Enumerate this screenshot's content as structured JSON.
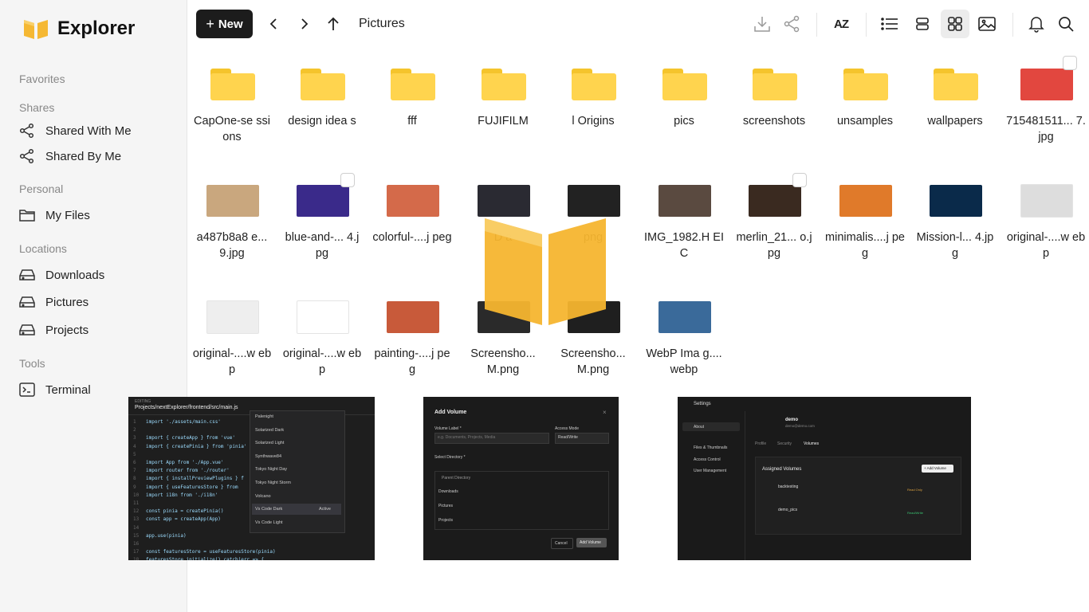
{
  "app": {
    "name": "Explorer"
  },
  "sidebar": {
    "sections": {
      "favorites": "Favorites",
      "shares": "Shares",
      "personal": "Personal",
      "locations": "Locations",
      "tools": "Tools"
    },
    "shares": [
      {
        "label": "Shared With Me",
        "icon": "share-icon"
      },
      {
        "label": "Shared By Me",
        "icon": "share-icon"
      }
    ],
    "personal": [
      {
        "label": "My Files",
        "icon": "folder-icon"
      }
    ],
    "locations": [
      {
        "label": "Downloads",
        "icon": "drive-icon"
      },
      {
        "label": "Pictures",
        "icon": "drive-icon"
      },
      {
        "label": "Projects",
        "icon": "drive-icon"
      }
    ],
    "tools": [
      {
        "label": "Terminal",
        "icon": "terminal-icon"
      }
    ]
  },
  "toolbar": {
    "new_label": "New",
    "breadcrumb": "Pictures",
    "sort_label": "AZ"
  },
  "files": [
    {
      "name": "CapOne-sessions",
      "display": "CapOne-se ssions",
      "type": "folder"
    },
    {
      "name": "design ideas",
      "display": "design idea s",
      "type": "folder"
    },
    {
      "name": "fff",
      "display": "fff",
      "type": "folder"
    },
    {
      "name": "FUJIFILM",
      "display": "FUJIFILM",
      "type": "folder"
    },
    {
      "name": "l Origins",
      "display": "l Origins",
      "type": "folder"
    },
    {
      "name": "pics",
      "display": "pics",
      "type": "folder"
    },
    {
      "name": "screenshots",
      "display": "screenshots",
      "type": "folder"
    },
    {
      "name": "unsamples",
      "display": "unsamples",
      "type": "folder"
    },
    {
      "name": "wallpapers",
      "display": "wallpapers",
      "type": "folder"
    },
    {
      "name": "715481511...7.jpg",
      "display": "715481511... 7.jpg",
      "type": "image",
      "color": "#e2473f"
    },
    {
      "name": "a487b8a8e...9.jpg",
      "display": "a487b8a8 e...9.jpg",
      "type": "image",
      "color": "#c9a77e"
    },
    {
      "name": "blue-and-...4.jpg",
      "display": "blue-and-... 4.jpg",
      "type": "image",
      "color": "#3a2a8a"
    },
    {
      "name": "colorful-....jpeg",
      "display": "colorful-....j peg",
      "type": "image",
      "color": "#d46a4a"
    },
    {
      "name": "D...",
      "display": "D a",
      "type": "image",
      "color": "#2a2a32"
    },
    {
      "name": "...png",
      "display": "png",
      "type": "image",
      "color": "#222222"
    },
    {
      "name": "IMG_1982.HEIC",
      "display": "IMG_1982.H EIC",
      "type": "image",
      "color": "#5a4a40"
    },
    {
      "name": "merlin_21...o.jpg",
      "display": "merlin_21... o.jpg",
      "type": "image",
      "color": "#3a2a20"
    },
    {
      "name": "minimalis....jpeg",
      "display": "minimalis....j peg",
      "type": "image",
      "color": "#e07a2a"
    },
    {
      "name": "Mission-l...4.jpg",
      "display": "Mission-l... 4.jpg",
      "type": "image",
      "color": "#0a2a4a"
    },
    {
      "name": "original-....webp",
      "display": "original-....w ebp",
      "type": "image",
      "color": "#dddddd"
    },
    {
      "name": "original-....webp",
      "display": "original-....w ebp",
      "type": "image",
      "color": "#eeeeee"
    },
    {
      "name": "original-....webp",
      "display": "original-....w ebp",
      "type": "image",
      "color": "#ffffff"
    },
    {
      "name": "painting-....jpeg",
      "display": "painting-....j peg",
      "type": "image",
      "color": "#c85a3a"
    },
    {
      "name": "Screensho...M.png",
      "display": "Screensho... M.png",
      "type": "image",
      "color": "#2a2a2a"
    },
    {
      "name": "Screensho...M.png",
      "display": "Screensho... M.png",
      "type": "image",
      "color": "#1f1f1f"
    },
    {
      "name": "WebP Imag....webp",
      "display": "WebP Ima g....webp",
      "type": "image",
      "color": "#3a6a9a"
    }
  ],
  "previews": {
    "editor": {
      "header": "EDITING",
      "path": "Projects/nextExplorer/frontend/src/main.js",
      "lines": [
        "import './assets/main.css'",
        "",
        "import { createApp } from 'vue'",
        "import { createPinia } from 'pinia'",
        "",
        "import App from './App.vue'",
        "import router from './router'",
        "import { installPreviewPlugins } f",
        "import { useFeaturesStore } from",
        "import i18n from './i18n'",
        "",
        "const pinia = createPinia()",
        "const app = createApp(App)",
        "",
        "app.use(pinia)",
        "",
        "const featuresStore = useFeaturesStore(pinia)",
        "featuresStore.initialize().catch(err => {"
      ],
      "themes": [
        "Palenight",
        "Solarized Dark",
        "Solarized Light",
        "Synthwave84",
        "Tokyo Night Day",
        "Tokyo Night Storm",
        "Volcano",
        "Vs Code Dark",
        "Vs Code Light"
      ],
      "active_theme": "Vs Code Dark",
      "active_badge": "Active"
    },
    "add_volume": {
      "title": "Add Volume",
      "volume_label": "Volume Label *",
      "volume_placeholder": "e.g. Documents, Projects, Media",
      "access_mode": "Access Mode",
      "access_value": "Read/Write",
      "select_dir": "Select Directory *",
      "parent": "Parent Directory",
      "dirs": [
        "Downloads",
        "Pictures",
        "Projects"
      ],
      "cancel": "Cancel",
      "submit": "Add Volume"
    },
    "settings": {
      "title": "Settings",
      "nav": [
        "About",
        "Files & Thumbnails",
        "Access Control",
        "User Management"
      ],
      "user": "demo",
      "email": "demo@demo.com",
      "tabs": [
        "Profile",
        "Security",
        "Volumes"
      ],
      "assigned": "Assigned Volumes",
      "add_btn": "+ Add Volume",
      "volumes": [
        {
          "name": "backtesting",
          "mode": "Read Only"
        },
        {
          "name": "demo_pics",
          "mode": "Read/Write"
        }
      ]
    }
  }
}
